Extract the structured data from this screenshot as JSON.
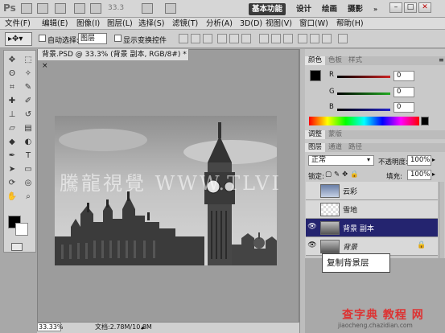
{
  "app": {
    "logo": "Ps",
    "zoom": "33.3",
    "workspaces": [
      "基本功能",
      "设计",
      "绘画",
      "摄影"
    ]
  },
  "menu": [
    "文件(F)",
    "编辑(E)",
    "图像(I)",
    "图层(L)",
    "选择(S)",
    "滤镜(T)",
    "分析(A)",
    "3D(D)",
    "视图(V)",
    "窗口(W)",
    "帮助(H)"
  ],
  "options": {
    "auto_select": "自动选择:",
    "layer_dropdown": "图层",
    "show_transform": "显示变换控件"
  },
  "document": {
    "tab": "背景.PSD @ 33.3% (背景 副本, RGB/8#) * ×",
    "zoom": "33.33%",
    "file_size": "文档:2.78M/10.8M",
    "watermark": "騰龍視覺 WWW.TLVI"
  },
  "color_panel": {
    "tabs": [
      "颜色",
      "色板",
      "样式"
    ],
    "channels": [
      {
        "name": "R",
        "value": "0",
        "color": "#cc2222"
      },
      {
        "name": "G",
        "value": "0",
        "color": "#22aa22"
      },
      {
        "name": "B",
        "value": "0",
        "color": "#2222cc"
      }
    ]
  },
  "adjust_tabs": [
    "调整",
    "蒙版"
  ],
  "layers_panel": {
    "tabs": [
      "图层",
      "通道",
      "路径"
    ],
    "blend_mode": "正常",
    "opacity_label": "不透明度:",
    "opacity": "100%",
    "lock_label": "锁定:",
    "fill_label": "填充:",
    "fill": "100%",
    "layers": [
      {
        "name": "云彩",
        "visible": false,
        "selected": false
      },
      {
        "name": "雪地",
        "visible": false,
        "selected": false
      },
      {
        "name": "背景 副本",
        "visible": true,
        "selected": true
      },
      {
        "name": "背景",
        "visible": true,
        "selected": false
      }
    ]
  },
  "tooltip": "复制背景层",
  "site_watermark": {
    "title": "查字典 教程 网",
    "url": "jiaocheng.chazidian.com"
  }
}
